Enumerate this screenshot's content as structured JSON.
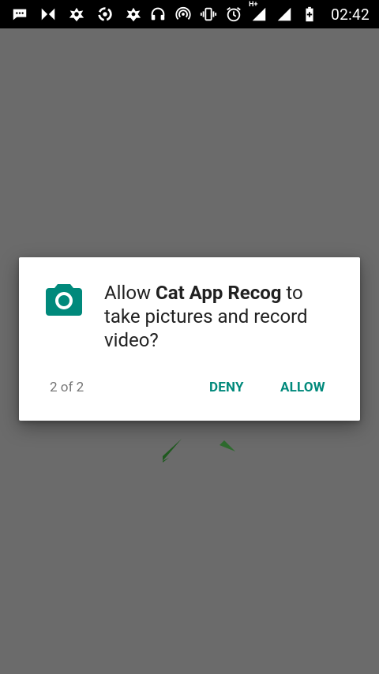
{
  "status_bar": {
    "left_icons": [
      "message-icon",
      "bowtie-icon",
      "avast-icon",
      "sync-icon",
      "bug-icon"
    ],
    "right_icons": [
      "headset-icon",
      "hotspot-icon",
      "vibrate-icon",
      "alarm-icon",
      "signal-h-plus-icon",
      "signal-icon",
      "battery-charging-icon"
    ],
    "network_label": "H+",
    "time": "02:42"
  },
  "dialog": {
    "icon": "camera-icon",
    "message_prefix": "Allow ",
    "app_name": "Cat App Recog",
    "message_suffix": " to take pictures and record video?",
    "counter": "2 of 2",
    "deny_label": "DENY",
    "allow_label": "ALLOW"
  },
  "colors": {
    "accent": "#00897b",
    "scrim": "#6b6b6b",
    "dialog_bg": "#ffffff",
    "status_bar": "#000000"
  }
}
